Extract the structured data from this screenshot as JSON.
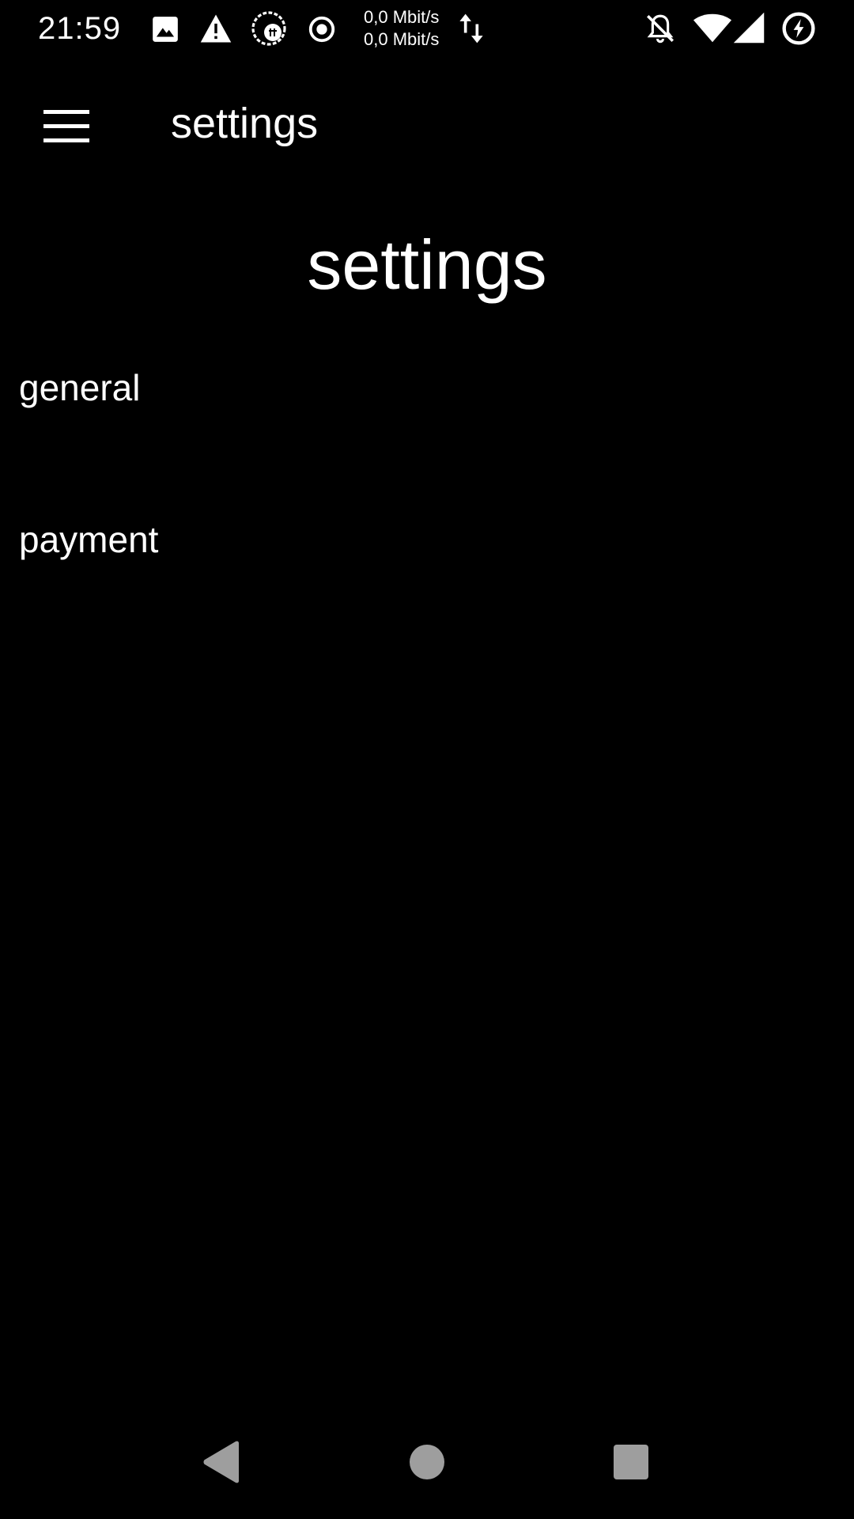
{
  "status_bar": {
    "time": "21:59",
    "net_speed_up": "0,0 Mbit/s",
    "net_speed_down": "0,0 Mbit/s",
    "icons": [
      "image-icon",
      "warning-icon",
      "vpn-shield-icon",
      "record-icon",
      "data-transfer-icon",
      "notifications-off-icon",
      "wifi-icon",
      "cell-signal-icon",
      "battery-saver-icon"
    ]
  },
  "toolbar": {
    "title": "settings",
    "menu_icon": "hamburger-menu-icon"
  },
  "main": {
    "heading": "settings",
    "items": [
      {
        "label": "general"
      },
      {
        "label": "payment"
      }
    ]
  },
  "nav_bar": {
    "buttons": [
      "back-icon",
      "home-icon",
      "recents-icon"
    ],
    "color": "#9e9e9e"
  },
  "colors": {
    "background": "#000000",
    "text": "#ffffff"
  }
}
